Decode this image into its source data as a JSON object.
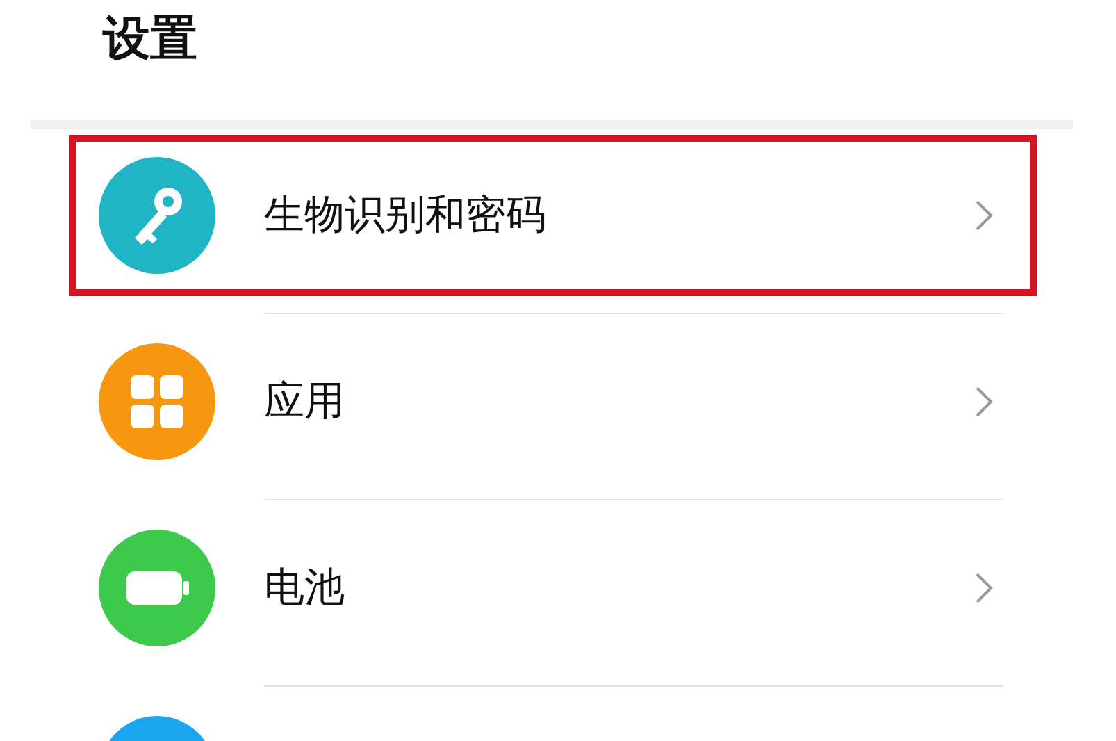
{
  "title": "设置",
  "items": [
    {
      "label": "生物识别和密码",
      "kind": "key",
      "color": "#1fb5c4",
      "highlighted": true
    },
    {
      "label": "应用",
      "kind": "apps",
      "color": "#f6970f",
      "highlighted": false
    },
    {
      "label": "电池",
      "kind": "battery",
      "color": "#3dc94c",
      "highlighted": false
    },
    {
      "kind": "other",
      "color": "#1aa6ee",
      "highlighted": false
    }
  ]
}
